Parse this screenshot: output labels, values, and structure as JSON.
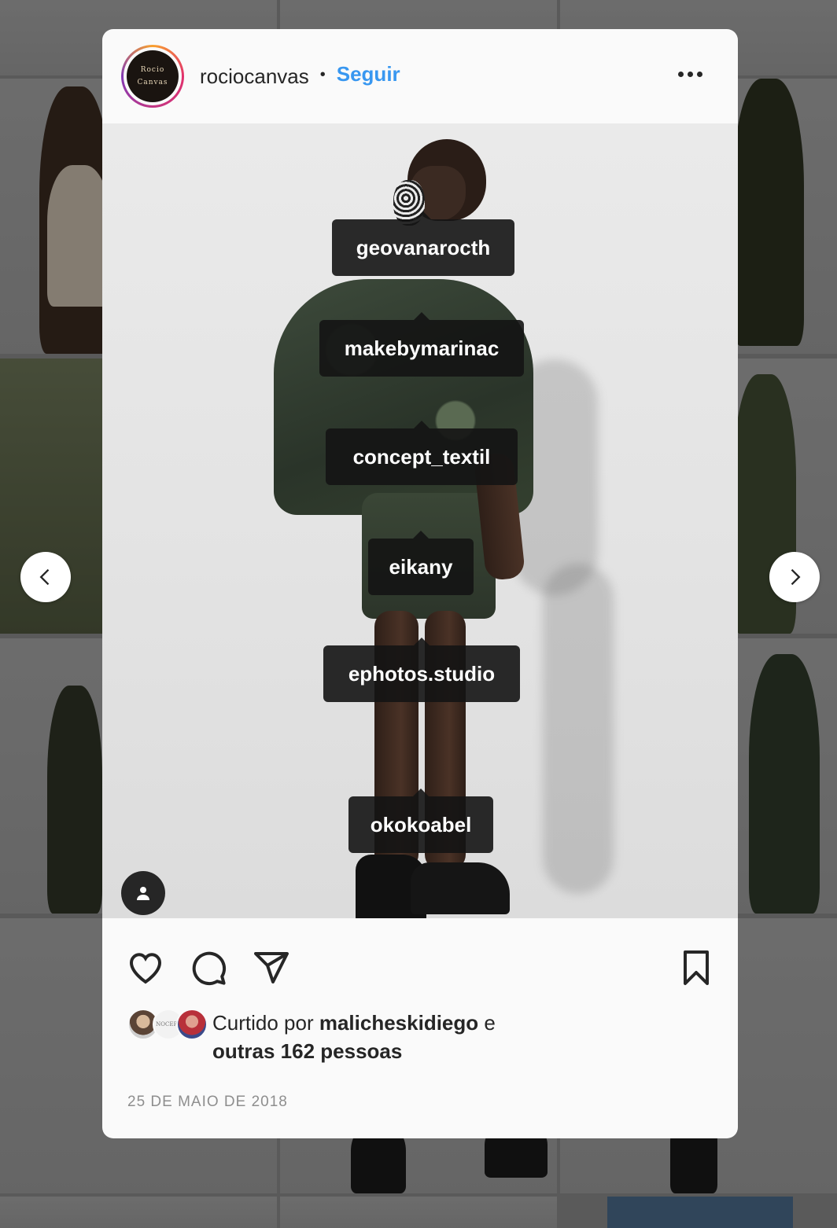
{
  "post": {
    "username": "rociocanvas",
    "separator": "•",
    "follow_label": "Seguir",
    "avatar_text_line1": "Rocio",
    "avatar_text_line2": "Canvas",
    "tags": [
      "geovanarocth",
      "makebymarinac",
      "concept_textil",
      "eikany",
      "ephotos.studio",
      "okokoabel"
    ],
    "likes": {
      "prefix": "Curtido por ",
      "user": "malicheskidiego",
      "middle": " e",
      "others": "outras 162 pessoas",
      "avatar2_text": "NOCEPT"
    },
    "date": "25 DE MAIO DE 2018"
  },
  "icons": {
    "more": "more-options-icon",
    "prev": "chevron-left-icon",
    "next": "chevron-right-icon",
    "tagged_people": "user-tag-icon",
    "like": "heart-icon",
    "comment": "comment-icon",
    "share": "share-icon",
    "save": "bookmark-icon"
  },
  "colors": {
    "accent": "#3897f0",
    "text": "#262626",
    "muted": "#8e8e8e",
    "tag_bg": "#141414"
  }
}
